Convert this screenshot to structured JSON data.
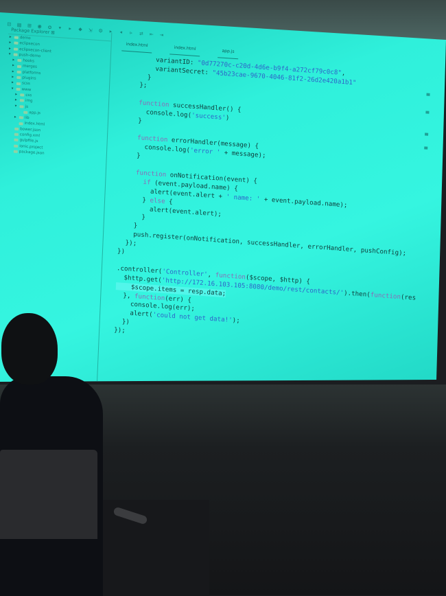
{
  "toolbar": {
    "text": "⊡ ▤ ⊞ ◉ ✪ ▾ ▸ ◆ ⇲ ⚙ ▸ ◂ ▹ ⇄ ⇤ ⇥"
  },
  "editor": {
    "tabs": [
      "index.html",
      "index.html",
      "app.js"
    ]
  },
  "explorer": {
    "title": "Package Explorer ⊠",
    "items": [
      {
        "label": "demo",
        "level": 0,
        "arrow": "▸"
      },
      {
        "label": "eclipsecon",
        "level": 0,
        "arrow": "▸"
      },
      {
        "label": "eclipsecon-client",
        "level": 0,
        "arrow": "▸"
      },
      {
        "label": "push-demo",
        "level": 0,
        "arrow": "▾"
      },
      {
        "label": "hooks",
        "level": 1,
        "arrow": "▸"
      },
      {
        "label": "merges",
        "level": 1,
        "arrow": "▸"
      },
      {
        "label": "platforms",
        "level": 1,
        "arrow": "▸"
      },
      {
        "label": "plugins",
        "level": 1,
        "arrow": "▸"
      },
      {
        "label": "scss",
        "level": 1,
        "arrow": "▸"
      },
      {
        "label": "www",
        "level": 1,
        "arrow": "▾"
      },
      {
        "label": "css",
        "level": 2,
        "arrow": "▸"
      },
      {
        "label": "img",
        "level": 2,
        "arrow": "▸"
      },
      {
        "label": "js",
        "level": 2,
        "arrow": "▾"
      },
      {
        "label": "app.js",
        "level": 3,
        "arrow": ""
      },
      {
        "label": "lib",
        "level": 2,
        "arrow": "▸"
      },
      {
        "label": "index.html",
        "level": 2,
        "arrow": ""
      },
      {
        "label": "bower.json",
        "level": 1,
        "arrow": ""
      },
      {
        "label": "config.xml",
        "level": 1,
        "arrow": ""
      },
      {
        "label": "gulpfile.js",
        "level": 1,
        "arrow": ""
      },
      {
        "label": "ionic.project",
        "level": 1,
        "arrow": ""
      },
      {
        "label": "package.json",
        "level": 1,
        "arrow": ""
      }
    ]
  },
  "code_lines": [
    [
      {
        "t": "        variantID: "
      },
      {
        "t": "\"0d77270c-c20d-4d6e-b9f4-a272cf79c0c8\"",
        "c": "str"
      },
      {
        "t": ","
      }
    ],
    [
      {
        "t": "        variantSecret: "
      },
      {
        "t": "\"45b23cae-9670-4046-81f2-26d2e420a1b1\"",
        "c": "str"
      }
    ],
    [
      {
        "t": "      }"
      }
    ],
    [
      {
        "t": "    };"
      }
    ],
    [
      {
        "t": ""
      }
    ],
    [
      {
        "t": "    "
      },
      {
        "t": "function",
        "c": "kw"
      },
      {
        "t": " successHandler() {"
      }
    ],
    [
      {
        "t": "      console.log("
      },
      {
        "t": "'success'",
        "c": "str"
      },
      {
        "t": ")"
      }
    ],
    [
      {
        "t": "    }"
      }
    ],
    [
      {
        "t": ""
      }
    ],
    [
      {
        "t": "    "
      },
      {
        "t": "function",
        "c": "kw"
      },
      {
        "t": " errorHandler(message) {"
      }
    ],
    [
      {
        "t": "      console.log("
      },
      {
        "t": "'error '",
        "c": "str"
      },
      {
        "t": " + message);"
      }
    ],
    [
      {
        "t": "    }"
      }
    ],
    [
      {
        "t": ""
      }
    ],
    [
      {
        "t": "    "
      },
      {
        "t": "function",
        "c": "kw"
      },
      {
        "t": " onNotification(event) {"
      }
    ],
    [
      {
        "t": "      "
      },
      {
        "t": "if",
        "c": "kw"
      },
      {
        "t": " (event.payload.name) {"
      }
    ],
    [
      {
        "t": "        alert(event.alert + "
      },
      {
        "t": "' name: '",
        "c": "str"
      },
      {
        "t": " + event.payload.name);"
      }
    ],
    [
      {
        "t": "      } "
      },
      {
        "t": "else",
        "c": "kw"
      },
      {
        "t": " {"
      }
    ],
    [
      {
        "t": "        alert(event.alert);"
      }
    ],
    [
      {
        "t": "      }"
      }
    ],
    [
      {
        "t": "    }"
      }
    ],
    [
      {
        "t": "    push.register(onNotification, successHandler, errorHandler, pushConfig);"
      }
    ],
    [
      {
        "t": "  });"
      }
    ],
    [
      {
        "t": "})"
      }
    ],
    [
      {
        "t": ""
      }
    ],
    [
      {
        "t": ".controller("
      },
      {
        "t": "'Controller'",
        "c": "str"
      },
      {
        "t": ", "
      },
      {
        "t": "function",
        "c": "kw"
      },
      {
        "t": "($scope, $http) {"
      }
    ],
    [
      {
        "t": "  $http.get("
      },
      {
        "t": "'http://172.16.103.105:8080/demo/rest/contacts/'",
        "c": "str"
      },
      {
        "t": ").then("
      },
      {
        "t": "function",
        "c": "kw"
      },
      {
        "t": "(res"
      }
    ],
    [
      {
        "t": "    $scope.items = resp.data;",
        "c": "hl"
      }
    ],
    [
      {
        "t": "  }, "
      },
      {
        "t": "function",
        "c": "kw"
      },
      {
        "t": "(err) {"
      }
    ],
    [
      {
        "t": "    console.log(err);"
      }
    ],
    [
      {
        "t": "    alert("
      },
      {
        "t": "'could not get data!'",
        "c": "str"
      },
      {
        "t": ");"
      }
    ],
    [
      {
        "t": "  })"
      }
    ],
    [
      {
        "t": "});"
      }
    ]
  ],
  "laptop": {
    "logo": ""
  },
  "colors": {
    "screen": "#2ff0db",
    "keyword": "#8a6bb8",
    "string": "#2f64c9",
    "text": "#0e3d3b"
  }
}
